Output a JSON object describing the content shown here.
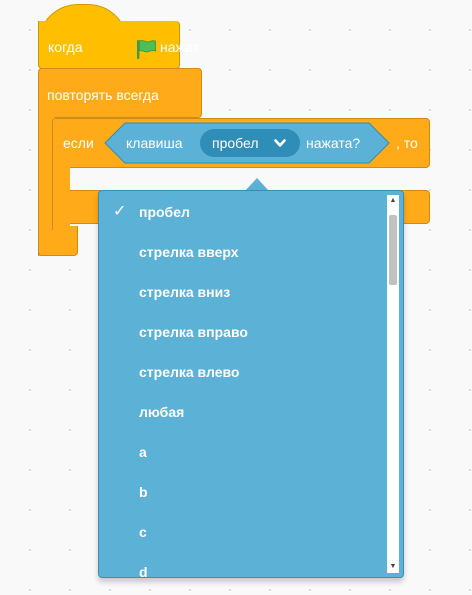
{
  "event_block": {
    "label_when": "когда",
    "label_clicked": "нажат",
    "icon": "green-flag-icon",
    "color": "#ffbf00"
  },
  "forever_block": {
    "label": "повторять всегда",
    "color": "#ffab19"
  },
  "if_block": {
    "label_if": "если",
    "label_then": ", то"
  },
  "sensing_block": {
    "label_key": "клавиша",
    "selected_key": "пробел",
    "label_pressed": "нажата?",
    "color": "#5cb1d6",
    "dropdown_icon": "chevron-down-icon"
  },
  "dropdown_menu": {
    "check_mark": "✓",
    "items": [
      {
        "label": "пробел",
        "selected": true
      },
      {
        "label": "стрелка вверх",
        "selected": false
      },
      {
        "label": "стрелка вниз",
        "selected": false
      },
      {
        "label": "стрелка вправо",
        "selected": false
      },
      {
        "label": "стрелка влево",
        "selected": false
      },
      {
        "label": "любая",
        "selected": false
      },
      {
        "label": "a",
        "selected": false
      },
      {
        "label": "b",
        "selected": false
      },
      {
        "label": "c",
        "selected": false
      },
      {
        "label": "d",
        "selected": false
      }
    ],
    "scroll_up_glyph": "▲",
    "scroll_down_glyph": "▼"
  }
}
